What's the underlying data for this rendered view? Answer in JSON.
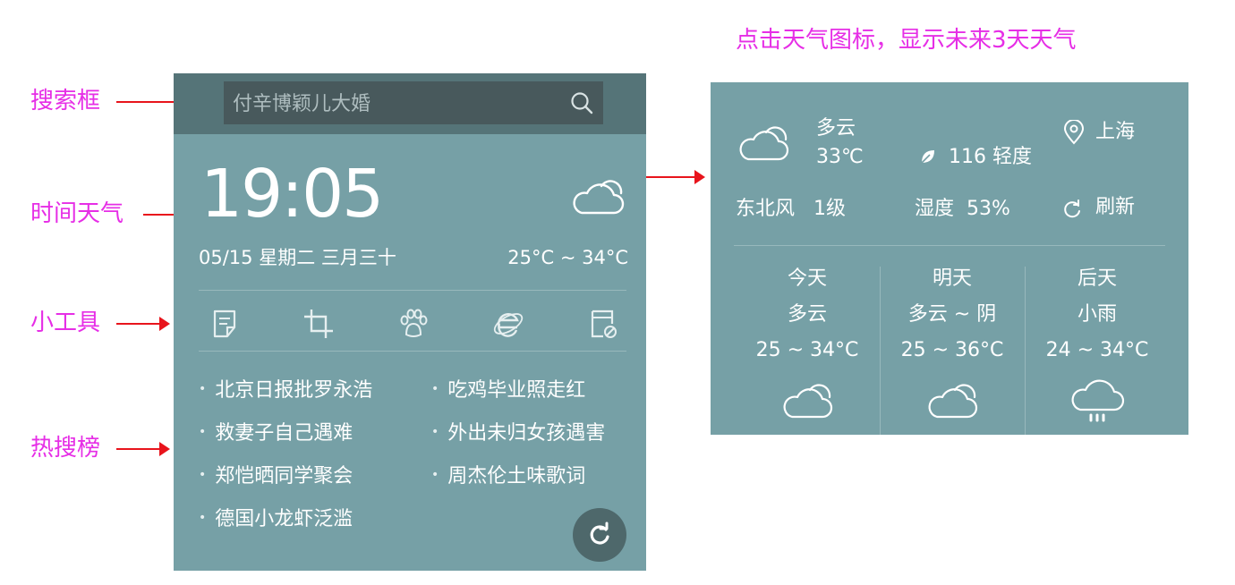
{
  "annotations": {
    "search_box": "搜索框",
    "time_weather": "时间天气",
    "tools": "小工具",
    "hot_search": "热搜榜",
    "weather_tip": "点击天气图标，显示未来3天天气"
  },
  "colors": {
    "panel_bg": "#76a0a6",
    "top_bar": "#557478",
    "search_bg": "#48595c",
    "annotation": "#e62ee6",
    "arrow": "#e8141c"
  },
  "widget": {
    "search": {
      "placeholder": "付辛博颖儿大婚",
      "icon": "search-icon"
    },
    "time": "19:05",
    "date_line": "05/15  星期二  三月三十",
    "temp_range": "25°C ~ 34°C",
    "weather_icon": "cloud-icon",
    "tools": [
      {
        "icon": "note-icon"
      },
      {
        "icon": "crop-icon"
      },
      {
        "icon": "paw-icon"
      },
      {
        "icon": "ie-browser-icon"
      },
      {
        "icon": "clean-icon"
      }
    ],
    "hot_list": [
      "北京日报批罗永浩",
      "吃鸡毕业照走红",
      "救妻子自己遇难",
      "外出未归女孩遇害",
      "郑恺晒同学聚会",
      "周杰伦土味歌词",
      "德国小龙虾泛滥"
    ],
    "refresh_icon": "refresh-icon"
  },
  "forecast": {
    "current": {
      "condition": "多云",
      "temperature": "33℃",
      "aqi": "116 轻度",
      "location": "上海",
      "wind": "东北风   1级",
      "humidity": "湿度  53%",
      "refresh_label": "刷新"
    },
    "days": [
      {
        "day": "今天",
        "condition": "多云",
        "temp": "25 ~ 34°C",
        "icon": "cloud-icon"
      },
      {
        "day": "明天",
        "condition": "多云 ~ 阴",
        "temp": "25 ~ 36°C",
        "icon": "cloud-icon"
      },
      {
        "day": "后天",
        "condition": "小雨",
        "temp": "24 ~ 34°C",
        "icon": "rain-icon"
      }
    ]
  }
}
